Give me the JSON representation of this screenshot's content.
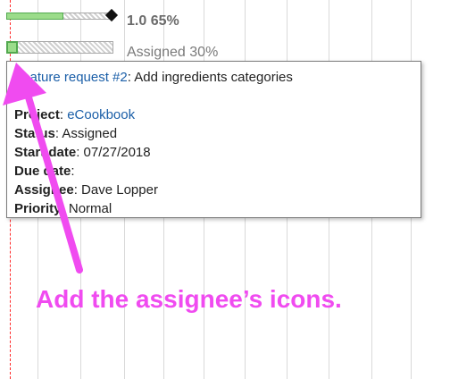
{
  "gantt": {
    "row1_label": "1.0 65%",
    "row2_label": "Assigned 30%"
  },
  "tooltip": {
    "title_link": "Feature request #2",
    "title_rest": ": Add ingredients categories",
    "rows": [
      {
        "key": "Project",
        "value": "eCookbook",
        "is_link": true
      },
      {
        "key": "Status",
        "value": "Assigned"
      },
      {
        "key": "Start date",
        "value": "07/27/2018"
      },
      {
        "key": "Due date",
        "value": ""
      },
      {
        "key": "Assignee",
        "value": "Dave Lopper"
      },
      {
        "key": "Priority",
        "value": "Normal"
      }
    ],
    "sep": ": "
  },
  "annotation": {
    "text": "Add the assignee’s icons.",
    "color": "#f04bf0"
  }
}
